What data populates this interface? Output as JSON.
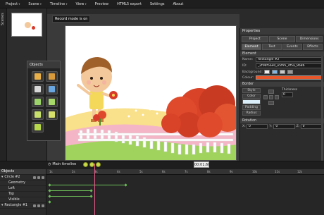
{
  "menu": {
    "items": [
      {
        "label": "Project",
        "arrow": true
      },
      {
        "label": "Scene",
        "arrow": true
      },
      {
        "label": "Timeline",
        "arrow": true
      },
      {
        "label": "View",
        "arrow": true
      },
      {
        "label": "Preview",
        "arrow": false
      },
      {
        "label": "HTML5 export",
        "arrow": false
      },
      {
        "label": "Settings",
        "arrow": false
      },
      {
        "label": "About",
        "arrow": false
      }
    ]
  },
  "scenes": {
    "label": "Scenes"
  },
  "stage": {
    "record_label": "Record mode is on"
  },
  "objects_panel": {
    "title": "Objects",
    "tiles": [
      {
        "icon": "image-object-icon",
        "color": "#e9b04a"
      },
      {
        "icon": "shape-object-icon",
        "color": "#d89a3a"
      },
      {
        "icon": "text-object-icon",
        "color": "#d8d8d8"
      },
      {
        "icon": "audio-object-icon",
        "color": "#6aa6e0"
      },
      {
        "icon": "document-object-icon",
        "color": "#9bd36a"
      },
      {
        "icon": "video-object-icon",
        "color": "#a6d86a"
      },
      {
        "icon": "note-object-icon",
        "color": "#c6e06a"
      },
      {
        "icon": "widget-object-icon",
        "color": "#d6e06a"
      },
      {
        "icon": "button-object-icon",
        "color": "#b6d84a"
      }
    ]
  },
  "properties": {
    "title": "Properties",
    "tabs_top": [
      "Project",
      "Scene",
      "Dimensions"
    ],
    "tabs_bottom": [
      "Element",
      "Text",
      "Events",
      "Effects"
    ],
    "active_tab": "Element",
    "element_section": "Element",
    "name_label": "Name:",
    "name_value": "Rectangle #2",
    "id_label": "ID:",
    "id_value": "_2f06f5ae0_e5f95_4f5a_9686",
    "background_label": "Background:",
    "colour_label": "Colour:",
    "colour_value": "#e8572c",
    "border_section": "Border",
    "border_style": "Style",
    "border_color": "Color",
    "border_padding": "Padding",
    "border_radius": "Radius",
    "thickness_label": "Thickness",
    "thickness_value": "0",
    "rotation_section": "Rotation",
    "rotation_x_label": "X:",
    "rotation_x": "0",
    "rotation_y_label": "Y:",
    "rotation_y": "0",
    "rotation_z_label": "Z:",
    "rotation_z": "0"
  },
  "timeline": {
    "title": "Main timeline",
    "time": "00:01,60",
    "ruler_marks": [
      "1s",
      "2s",
      "3s",
      "4s",
      "5s",
      "6s",
      "7s",
      "8s",
      "9s",
      "10s",
      "11s",
      "12s"
    ],
    "rows": [
      {
        "label": "Objects",
        "type": "header"
      },
      {
        "label": "Circle #2",
        "type": "object"
      },
      {
        "label": "Geometry",
        "type": "sub"
      },
      {
        "label": "Left",
        "type": "sub"
      },
      {
        "label": "Top",
        "type": "sub"
      },
      {
        "label": "Visible",
        "type": "sub"
      },
      {
        "label": "Rectangle #1",
        "type": "object"
      }
    ]
  }
}
